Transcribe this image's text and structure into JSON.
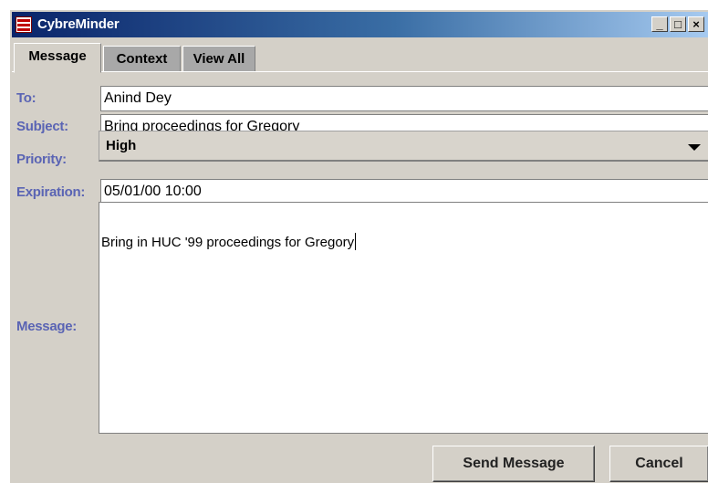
{
  "window": {
    "title": "CybreMinder",
    "controls": {
      "minimize": "_",
      "maximize": "□",
      "close": "×"
    }
  },
  "tabs": [
    {
      "label": "Message",
      "active": true
    },
    {
      "label": "Context",
      "active": false
    },
    {
      "label": "View All",
      "active": false
    }
  ],
  "form": {
    "to": {
      "label": "To:",
      "value": "Anind Dey"
    },
    "subject": {
      "label": "Subject:",
      "value": "Bring proceedings for Gregory"
    },
    "priority": {
      "label": "Priority:",
      "value": "High"
    },
    "expiration": {
      "label": "Expiration:",
      "value": "05/01/00 10:00"
    },
    "message": {
      "label": "Message:",
      "value": "Bring in HUC '99 proceedings for Gregory"
    }
  },
  "buttons": {
    "send": "Send Message",
    "cancel": "Cancel"
  },
  "colors": {
    "label": "#5a64b4",
    "titlebar_start": "#0a246a",
    "titlebar_end": "#a6caf0",
    "window_bg": "#d4d0c8"
  }
}
